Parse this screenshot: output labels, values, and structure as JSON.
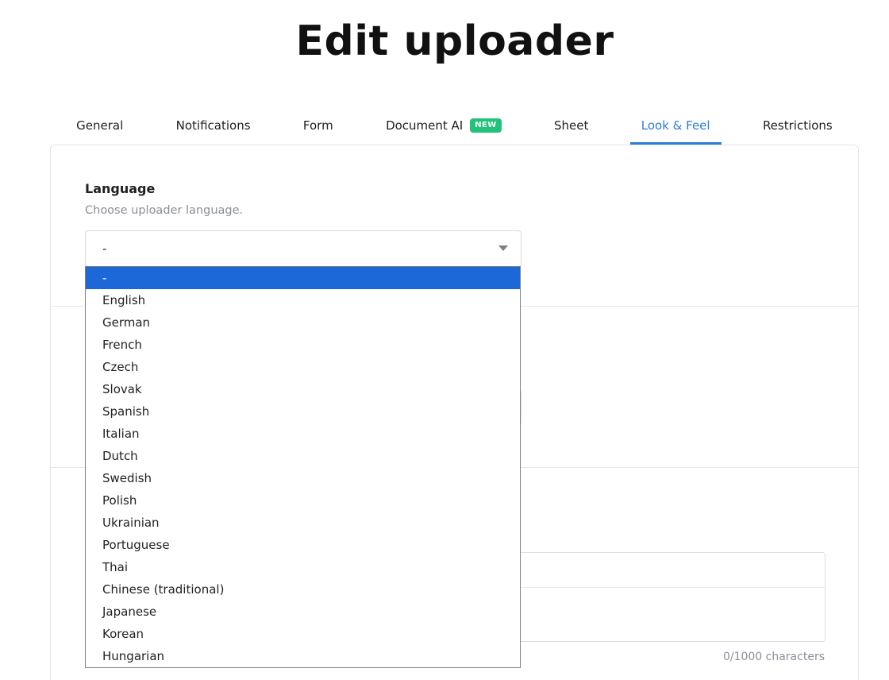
{
  "page": {
    "title": "Edit uploader"
  },
  "tabs": [
    {
      "label": "General"
    },
    {
      "label": "Notifications"
    },
    {
      "label": "Form"
    },
    {
      "label": "Document AI",
      "badge": "NEW"
    },
    {
      "label": "Sheet"
    },
    {
      "label": "Look & Feel",
      "active": true
    },
    {
      "label": "Restrictions"
    }
  ],
  "language": {
    "label": "Language",
    "help": "Choose uploader language.",
    "selected_value": "-",
    "options": [
      "-",
      "English",
      "German",
      "French",
      "Czech",
      "Slovak",
      "Spanish",
      "Italian",
      "Dutch",
      "Swedish",
      "Polish",
      "Ukrainian",
      "Portuguese",
      "Thai",
      "Chinese (traditional)",
      "Japanese",
      "Korean",
      "Hungarian"
    ]
  },
  "message": {
    "char_count": "0/1000 characters"
  },
  "colors": {
    "accent": "#2d7fd6",
    "badge": "#22c27a",
    "selected_option": "#1d68d8"
  }
}
